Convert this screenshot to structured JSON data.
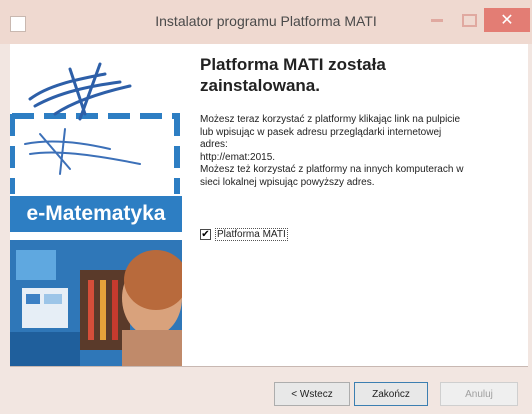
{
  "window": {
    "title": "Instalator programu Platforma MATI",
    "close_symbol": "✕"
  },
  "left_panel": {
    "brand": "e-Matematyka"
  },
  "main": {
    "heading": "Platforma MATI została zainstalowana.",
    "description": "Możesz teraz korzystać z platformy klikając link na pulpicie\nlub wpisując w pasek adresu przeglądarki internetowej\nadres:\nhttp://emat:2015.\nMożesz też korzystać z platformy na innych komputerach w\nsieci lokalnej wpisując powyższy adres.",
    "checkbox": {
      "label": "Platforma MATI",
      "checked": true,
      "mark": "✔"
    }
  },
  "buttons": {
    "back": "< Wstecz",
    "finish": "Zakończ",
    "cancel": "Anuluj"
  },
  "colors": {
    "accent": "#2d7ec3",
    "titlebar": "#efd9d0",
    "close": "#e37d74"
  }
}
